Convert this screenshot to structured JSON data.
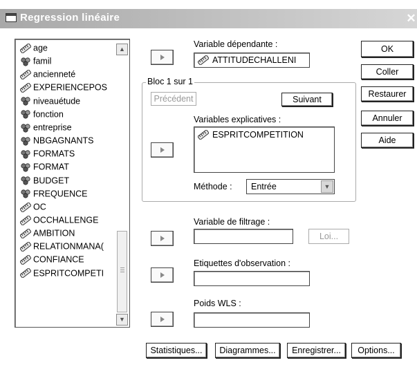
{
  "window": {
    "title": "Regression linéaire",
    "close_symbol": "✕"
  },
  "variables": [
    {
      "label": "age",
      "type": "scale"
    },
    {
      "label": "famil",
      "type": "nominal"
    },
    {
      "label": "ancienneté",
      "type": "scale"
    },
    {
      "label": "EXPERIENCEPOS",
      "type": "scale"
    },
    {
      "label": "niveauétude",
      "type": "nominal"
    },
    {
      "label": "fonction",
      "type": "nominal"
    },
    {
      "label": "entreprise",
      "type": "nominal"
    },
    {
      "label": "NBGAGNANTS",
      "type": "nominal"
    },
    {
      "label": "FORMATS",
      "type": "nominal"
    },
    {
      "label": "FORMAT",
      "type": "nominal"
    },
    {
      "label": "BUDGET",
      "type": "nominal"
    },
    {
      "label": "FREQUENCE",
      "type": "nominal"
    },
    {
      "label": "OC",
      "type": "scale"
    },
    {
      "label": "OCCHALLENGE",
      "type": "scale"
    },
    {
      "label": "AMBITION",
      "type": "scale"
    },
    {
      "label": "RELATIONMANA(",
      "type": "scale"
    },
    {
      "label": "CONFIANCE",
      "type": "scale"
    },
    {
      "label": "ESPRITCOMPETI",
      "type": "scale"
    }
  ],
  "dependent": {
    "label": "Variable dépendante :",
    "value": "ATTITUDECHALLENI"
  },
  "bloc": {
    "legend": "Bloc 1 sur 1",
    "previous_label": "Précédent",
    "next_label": "Suivant",
    "explicatives_label": "Variables explicatives :",
    "explicatives": [
      "ESPRITCOMPETITION"
    ],
    "methode_label": "Méthode :",
    "methode_value": "Entrée"
  },
  "filter": {
    "label": "Variable de filtrage :",
    "value": "",
    "rule_button": "Loi..."
  },
  "case_labels": {
    "label": "Etiquettes d'observation :",
    "value": ""
  },
  "wls": {
    "label": "Poids WLS :",
    "value": ""
  },
  "side_buttons": {
    "ok": "OK",
    "coller": "Coller",
    "restaurer": "Restaurer",
    "annuler": "Annuler",
    "aide": "Aide"
  },
  "bottom_buttons": {
    "statistiques": "Statistiques...",
    "diagrammes": "Diagrammes...",
    "enregistrer": "Enregistrer...",
    "options": "Options..."
  },
  "icons": {
    "scale": "ruler-icon",
    "nominal": "three-balls-icon"
  }
}
